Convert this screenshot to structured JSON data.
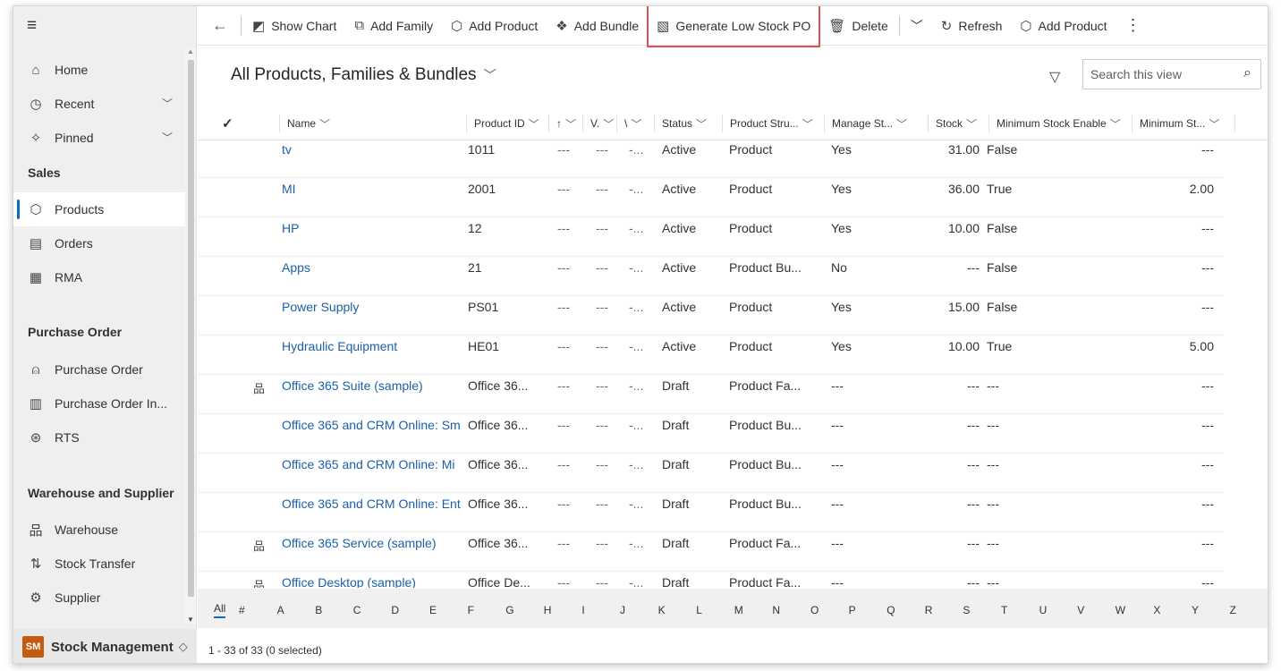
{
  "sidebar": {
    "items": {
      "home": "Home",
      "recent": "Recent",
      "pinned": "Pinned",
      "products": "Products",
      "orders": "Orders",
      "rma": "RMA",
      "purchase_order": "Purchase Order",
      "purchase_order_in": "Purchase Order In...",
      "rts": "RTS",
      "warehouse": "Warehouse",
      "stock_transfer": "Stock Transfer",
      "supplier": "Supplier"
    },
    "groups": {
      "sales": "Sales",
      "purchase": "Purchase Order",
      "warehouse": "Warehouse and Supplier"
    },
    "footer": {
      "badge": "SM",
      "label": "Stock Management"
    }
  },
  "commands": {
    "show_chart": "Show Chart",
    "add_family": "Add Family",
    "add_product": "Add Product",
    "add_bundle": "Add Bundle",
    "generate_po": "Generate Low Stock PO",
    "delete": "Delete",
    "refresh": "Refresh",
    "add_product2": "Add Product"
  },
  "view": {
    "title": "All Products, Families & Bundles",
    "search_placeholder": "Search this view"
  },
  "columns": {
    "name": "Name",
    "product_id": "Product ID",
    "c3": "↑",
    "c4": "V.",
    "c5": "\\",
    "status": "Status",
    "product_structure": "Product Stru...",
    "manage_stock": "Manage St...",
    "stock": "Stock",
    "min_stock_enable": "Minimum Stock Enable",
    "min_stock": "Minimum St..."
  },
  "rows": [
    {
      "name": "tv",
      "pid": "1011",
      "d1": "---",
      "d2": "---",
      "d3": "-...",
      "status": "Active",
      "ps": "Product",
      "ms": "Yes",
      "stock": "31.00",
      "mse": "False",
      "mst": "---",
      "family": false
    },
    {
      "name": "MI",
      "pid": "2001",
      "d1": "---",
      "d2": "---",
      "d3": "-...",
      "status": "Active",
      "ps": "Product",
      "ms": "Yes",
      "stock": "36.00",
      "mse": "True",
      "mst": "2.00",
      "family": false
    },
    {
      "name": "HP",
      "pid": "12",
      "d1": "---",
      "d2": "---",
      "d3": "-...",
      "status": "Active",
      "ps": "Product",
      "ms": "Yes",
      "stock": "10.00",
      "mse": "False",
      "mst": "---",
      "family": false
    },
    {
      "name": "Apps",
      "pid": "21",
      "d1": "---",
      "d2": "---",
      "d3": "-...",
      "status": "Active",
      "ps": "Product Bu...",
      "ms": "No",
      "stock": "---",
      "mse": "False",
      "mst": "---",
      "family": false
    },
    {
      "name": "Power Supply",
      "pid": "PS01",
      "d1": "---",
      "d2": "---",
      "d3": "-...",
      "status": "Active",
      "ps": "Product",
      "ms": "Yes",
      "stock": "15.00",
      "mse": "False",
      "mst": "---",
      "family": false
    },
    {
      "name": "Hydraulic Equipment",
      "pid": "HE01",
      "d1": "---",
      "d2": "---",
      "d3": "-...",
      "status": "Active",
      "ps": "Product",
      "ms": "Yes",
      "stock": "10.00",
      "mse": "True",
      "mst": "5.00",
      "family": false
    },
    {
      "name": "Office 365 Suite (sample)",
      "pid": "Office 36...",
      "d1": "---",
      "d2": "---",
      "d3": "-...",
      "status": "Draft",
      "ps": "Product Fa...",
      "ms": "---",
      "stock": "---",
      "mse": "---",
      "mst": "---",
      "family": true
    },
    {
      "name": "Office 365 and CRM Online: Sm",
      "pid": "Office 36...",
      "d1": "---",
      "d2": "---",
      "d3": "-...",
      "status": "Draft",
      "ps": "Product Bu...",
      "ms": "---",
      "stock": "---",
      "mse": "---",
      "mst": "---",
      "family": false
    },
    {
      "name": "Office 365 and CRM Online: Mi",
      "pid": "Office 36...",
      "d1": "---",
      "d2": "---",
      "d3": "-...",
      "status": "Draft",
      "ps": "Product Bu...",
      "ms": "---",
      "stock": "---",
      "mse": "---",
      "mst": "---",
      "family": false
    },
    {
      "name": "Office 365 and CRM Online: Ent",
      "pid": "Office 36...",
      "d1": "---",
      "d2": "---",
      "d3": "-...",
      "status": "Draft",
      "ps": "Product Bu...",
      "ms": "---",
      "stock": "---",
      "mse": "---",
      "mst": "---",
      "family": false
    },
    {
      "name": "Office 365 Service (sample)",
      "pid": "Office 36...",
      "d1": "---",
      "d2": "---",
      "d3": "-...",
      "status": "Draft",
      "ps": "Product Fa...",
      "ms": "---",
      "stock": "---",
      "mse": "---",
      "mst": "---",
      "family": true
    },
    {
      "name": "Office Desktop (sample)",
      "pid": "Office De...",
      "d1": "---",
      "d2": "---",
      "d3": "-...",
      "status": "Draft",
      "ps": "Product Fa...",
      "ms": "---",
      "stock": "---",
      "mse": "---",
      "mst": "---",
      "family": true
    }
  ],
  "alphabet": [
    "All",
    "#",
    "A",
    "B",
    "C",
    "D",
    "E",
    "F",
    "G",
    "H",
    "I",
    "J",
    "K",
    "L",
    "M",
    "N",
    "O",
    "P",
    "Q",
    "R",
    "S",
    "T",
    "U",
    "V",
    "W",
    "X",
    "Y",
    "Z"
  ],
  "status_text": "1 - 33 of 33 (0 selected)",
  "colors": {
    "accent": "#0f6cbd",
    "link": "#1b5faa",
    "highlight": "#e05050",
    "badge": "#c55a11"
  }
}
